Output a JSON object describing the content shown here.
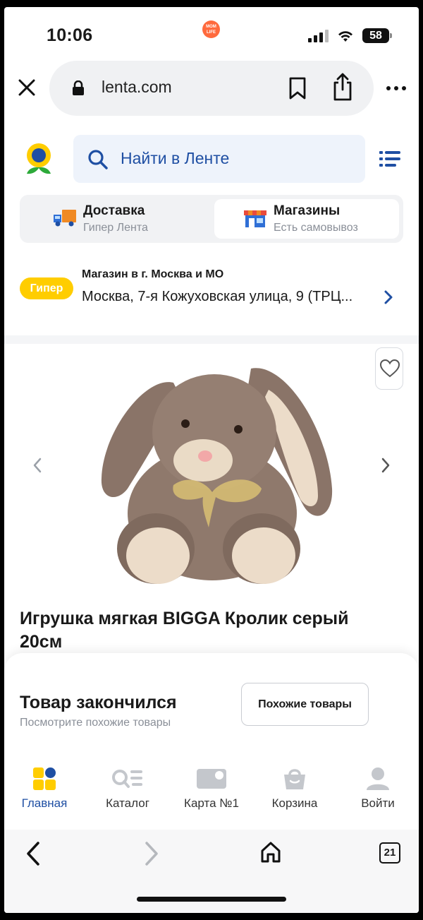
{
  "status_bar": {
    "time": "10:06",
    "app_badge": "MOM LIFE",
    "battery": "58"
  },
  "browser": {
    "url": "lenta.com",
    "tabs_count": "21"
  },
  "header": {
    "search_placeholder": "Найти в Ленте"
  },
  "delivery_tabs": [
    {
      "title": "Доставка",
      "subtitle": "Гипер Лента",
      "active": false
    },
    {
      "title": "Магазины",
      "subtitle": "Есть самовывоз",
      "active": true
    }
  ],
  "store": {
    "badge": "Гипер",
    "title": "Магазин в г. Москва и МО",
    "address": "Москва, 7-я Кожуховская улица, 9 (ТРЦ..."
  },
  "product": {
    "title": "Игрушка мягкая BIGGA Кролик серый 20см"
  },
  "availability": {
    "title": "Товар закончился",
    "subtitle": "Посмотрите похожие товары",
    "button": "Похожие товары"
  },
  "bottom_nav": [
    {
      "label": "Главная",
      "icon": "home-tiles-icon",
      "active": true
    },
    {
      "label": "Каталог",
      "icon": "catalog-icon",
      "active": false
    },
    {
      "label": "Карта №1",
      "icon": "loyalty-card-icon",
      "active": false
    },
    {
      "label": "Корзина",
      "icon": "basket-icon",
      "active": false
    },
    {
      "label": "Войти",
      "icon": "user-icon",
      "active": false
    }
  ],
  "colors": {
    "brand_blue": "#1f4fa3",
    "accent_yellow": "#ffcd00",
    "nav_gray": "#c4c7cc"
  }
}
